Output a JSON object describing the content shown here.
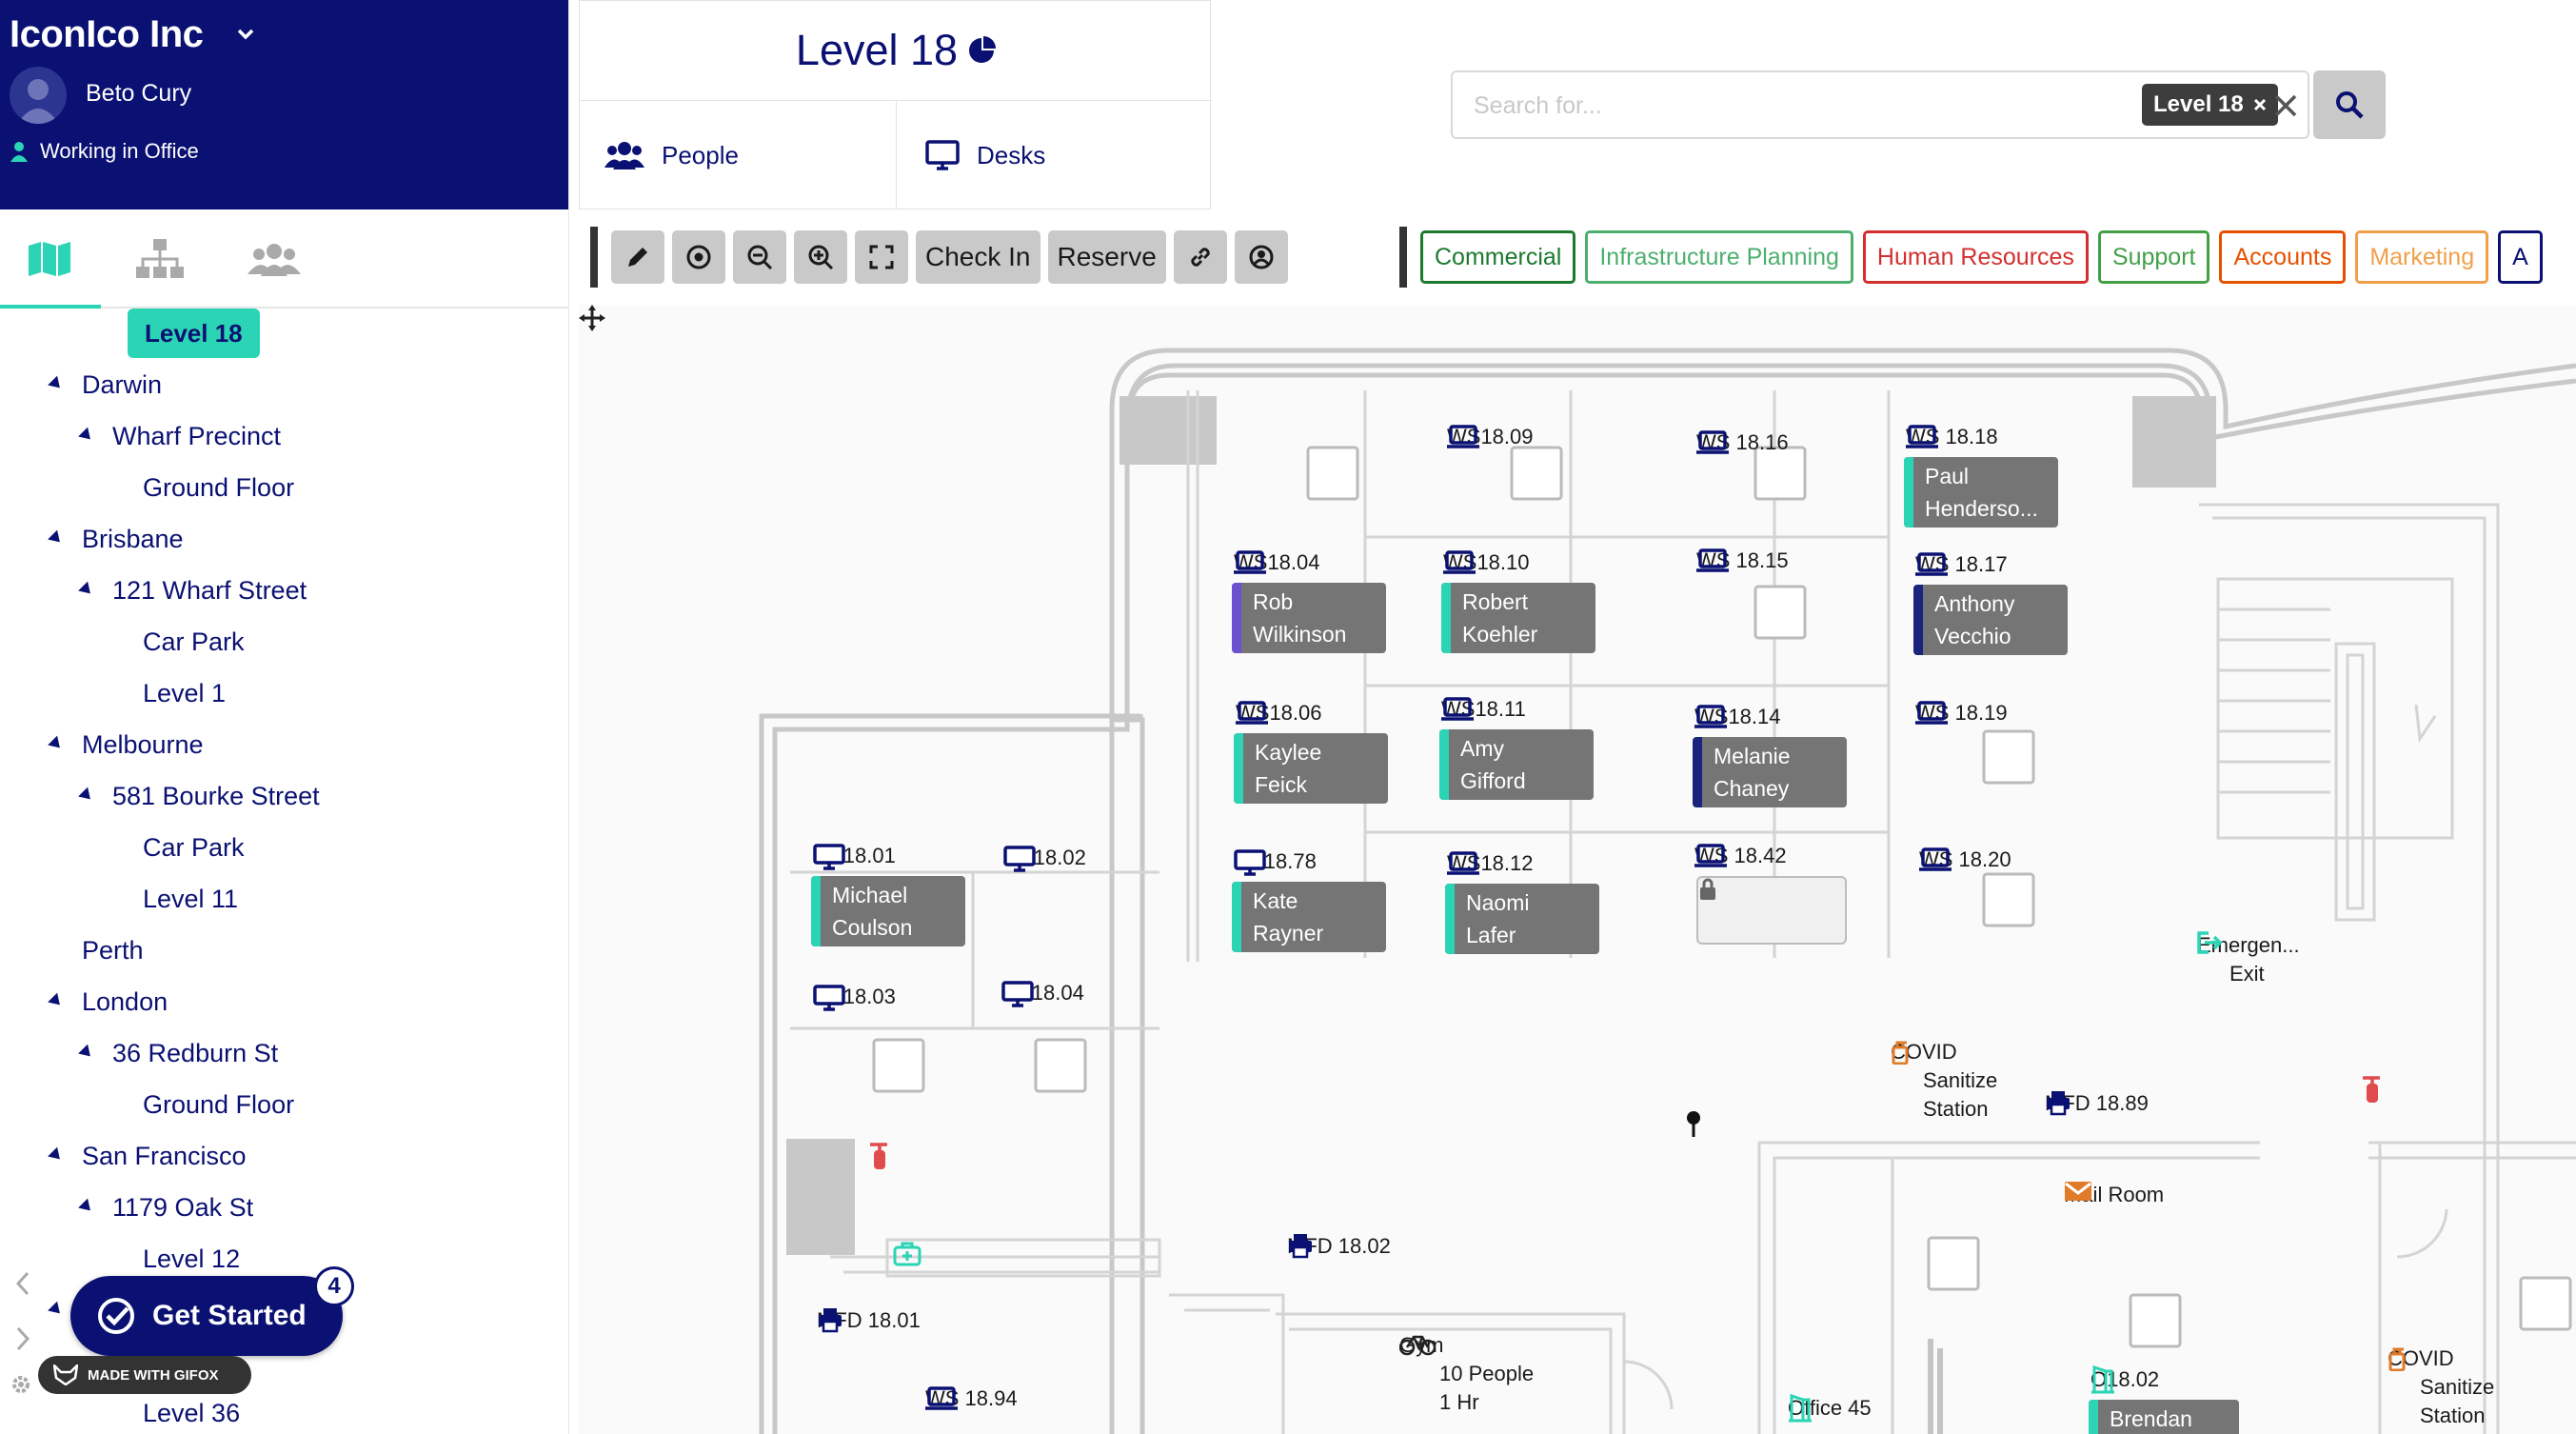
{
  "org": {
    "name": "IconIco Inc",
    "user": "Beto Cury",
    "status": "Working in Office"
  },
  "sidebar": {
    "root": "Level 18",
    "tree": [
      {
        "label": "Darwin",
        "depth": 0,
        "expanded": true
      },
      {
        "label": "Wharf Precinct",
        "depth": 1,
        "expanded": true
      },
      {
        "label": "Ground Floor",
        "depth": 2
      },
      {
        "label": "Brisbane",
        "depth": 0,
        "expanded": true
      },
      {
        "label": "121 Wharf Street",
        "depth": 1,
        "expanded": true
      },
      {
        "label": "Car Park",
        "depth": 2
      },
      {
        "label": "Level 1",
        "depth": 2
      },
      {
        "label": "Melbourne",
        "depth": 0,
        "expanded": true
      },
      {
        "label": "581 Bourke Street",
        "depth": 1,
        "expanded": true
      },
      {
        "label": "Car Park",
        "depth": 2
      },
      {
        "label": "Level 11",
        "depth": 2
      },
      {
        "label": "Perth",
        "depth": 0
      },
      {
        "label": "London",
        "depth": 0,
        "expanded": true
      },
      {
        "label": "36 Redburn St",
        "depth": 1,
        "expanded": true
      },
      {
        "label": "Ground Floor",
        "depth": 2
      },
      {
        "label": "San Francisco",
        "depth": 0,
        "expanded": true
      },
      {
        "label": "1179 Oak St",
        "depth": 1,
        "expanded": true
      },
      {
        "label": "Level 12",
        "depth": 2
      },
      {
        "label": "",
        "depth": 0,
        "expanded": true
      },
      {
        "label": "",
        "depth": 1
      },
      {
        "label": "Level 36",
        "depth": 2
      }
    ],
    "get_started": "Get Started",
    "get_started_count": "4",
    "gifox": "MADE WITH GIFOX"
  },
  "level": {
    "title": "Level 18",
    "tabs": {
      "people": "People",
      "desks": "Desks"
    }
  },
  "search": {
    "placeholder": "Search for...",
    "value": "",
    "chip": "Level 18"
  },
  "toolbar": {
    "check_in": "Check In",
    "reserve": "Reserve"
  },
  "departments": [
    {
      "label": "Commercial",
      "color": "#1b7a2e"
    },
    {
      "label": "Infrastructure Planning",
      "color": "#4caf6e"
    },
    {
      "label": "Human Resources",
      "color": "#d32f2f"
    },
    {
      "label": "Support",
      "color": "#43a047"
    },
    {
      "label": "Accounts",
      "color": "#e65100"
    },
    {
      "label": "Marketing",
      "color": "#f0a04b"
    },
    {
      "label": "A",
      "color": "#0a1172"
    }
  ],
  "desks": [
    {
      "id": "WS18.09",
      "icon": "laptop-icon"
    },
    {
      "id": "WS 18.16",
      "icon": "laptop-icon"
    },
    {
      "id": "WS 18.18",
      "icon": "laptop-icon",
      "first": "Paul",
      "last": "Henderso...",
      "stripe": "#2bd4b5"
    },
    {
      "id": "WS18.04",
      "icon": "laptop-icon",
      "first": "Rob",
      "last": "Wilkinson",
      "stripe": "#6a4fd0"
    },
    {
      "id": "WS18.10",
      "icon": "laptop-icon",
      "first": "Robert",
      "last": "Koehler",
      "stripe": "#2bd4b5"
    },
    {
      "id": "WS 18.15",
      "icon": "laptop-icon"
    },
    {
      "id": "WS 18.17",
      "icon": "laptop-icon",
      "first": "Anthony",
      "last": "Vecchio",
      "stripe": "#1a237e"
    },
    {
      "id": "WS18.06",
      "icon": "laptop-icon",
      "first": "Kaylee",
      "last": "Feick",
      "stripe": "#2bd4b5"
    },
    {
      "id": "WS18.11",
      "icon": "laptop-icon",
      "first": "Amy",
      "last": "Gifford",
      "stripe": "#2bd4b5"
    },
    {
      "id": "WS18.14",
      "icon": "laptop-icon",
      "first": "Melanie",
      "last": "Chaney",
      "stripe": "#1a237e"
    },
    {
      "id": "WS 18.19",
      "icon": "laptop-icon"
    },
    {
      "id": "HD18.01",
      "icon": "monitor-icon",
      "first": "Michael",
      "last": "Coulson",
      "stripe": "#2bd4b5"
    },
    {
      "id": "HD18.02",
      "icon": "monitor-icon"
    },
    {
      "id": "HD18.78",
      "icon": "monitor-icon",
      "first": "Kate",
      "last": "Rayner",
      "stripe": "#2bd4b5"
    },
    {
      "id": "WS18.12",
      "icon": "laptop-icon",
      "first": "Naomi",
      "last": "Lafer",
      "stripe": "#2bd4b5"
    },
    {
      "id": "WS 18.42",
      "icon": "laptop-icon",
      "locked": true
    },
    {
      "id": "WS 18.20",
      "icon": "laptop-icon"
    },
    {
      "id": "HD18.03",
      "icon": "monitor-icon"
    },
    {
      "id": "HD18.04",
      "icon": "monitor-icon"
    },
    {
      "id": "WS 18.94",
      "icon": "laptop-icon"
    }
  ],
  "pois": {
    "emergency": {
      "l1": "Emergen...",
      "l2": "Exit"
    },
    "covid1": {
      "l1": "COVID",
      "l2": "Sanitize",
      "l3": "Station"
    },
    "mfd1889": "MFD 18.89",
    "mailroom": "Mail Room",
    "mfd1802": "MFD 18.02",
    "mfd1801": "MFD 18.01",
    "gym": {
      "l1": "Gym",
      "l2": "10 People",
      "l3": "1 Hr"
    },
    "office45": "Office 45",
    "o1802": {
      "l1": "O18.02",
      "l2": "Brendan"
    },
    "covid2": {
      "l1": "COVID",
      "l2": "Sanitize",
      "l3": "Station"
    }
  },
  "colors": {
    "brand": "#0a1172",
    "accent": "#2bd4b5",
    "occupied": "#757575"
  }
}
